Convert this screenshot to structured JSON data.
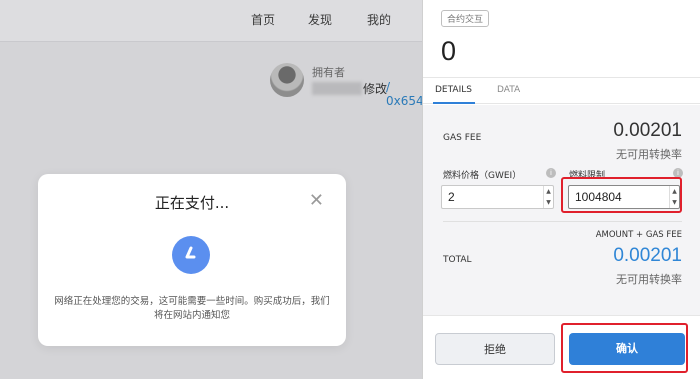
{
  "nav": {
    "items": [
      "首页",
      "发现",
      "我的"
    ]
  },
  "owner": {
    "label": "拥有者",
    "name_suffix": "修改",
    "address": "/ 0x654"
  },
  "pay_dialog": {
    "title": "正在支付...",
    "message": "网络正在处理您的交易，这可能需要一些时间。购买成功后，我们将在网站内通知您"
  },
  "metamask": {
    "badge": "合约交互",
    "amount": "0",
    "tabs": [
      "DETAILS",
      "DATA"
    ],
    "gas_fee_label": "GAS FEE",
    "gas_fee_value": "0.00201",
    "gas_fee_rate": "无可用转换率",
    "gas_price_label": "燃料价格（GWEI）",
    "gas_price_value": "2",
    "gas_limit_label": "燃料限制",
    "gas_limit_value": "1004804",
    "amount_gas_label": "AMOUNT + GAS FEE",
    "total_label": "TOTAL",
    "total_value": "0.00201",
    "total_rate": "无可用转换率",
    "reject_label": "拒绝",
    "confirm_label": "确认"
  },
  "colors": {
    "accent": "#2f80d8",
    "highlight": "#e0202c",
    "spinner": "#5b8fef"
  }
}
